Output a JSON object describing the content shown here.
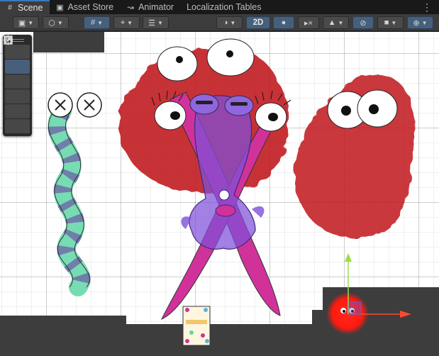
{
  "tabs": [
    {
      "label": "Scene",
      "icon": "grid-icon",
      "active": true
    },
    {
      "label": "Asset Store",
      "icon": "shopping-bag-icon",
      "active": false
    },
    {
      "label": "Animator",
      "icon": "animator-icon",
      "active": false
    },
    {
      "label": "Localization Tables",
      "icon": "",
      "active": false
    }
  ],
  "toolbar": {
    "mode_2d_label": "2D"
  },
  "tools": [
    {
      "name": "hand-tool",
      "icon": "hand-icon",
      "selected": false
    },
    {
      "name": "move-tool",
      "icon": "move-arrows-icon",
      "selected": true
    },
    {
      "name": "rotate-tool",
      "icon": "rotate-icon",
      "selected": false
    },
    {
      "name": "scale-tool",
      "icon": "scale-icon",
      "selected": false
    },
    {
      "name": "rect-tool",
      "icon": "rect-transform-icon",
      "selected": false
    },
    {
      "name": "transform-tool",
      "icon": "transform-icon",
      "selected": false
    }
  ],
  "colors": {
    "accent": "#46607c",
    "red_monster": "#c0141e",
    "purple_monster": "#7f4fd9",
    "pink_arms": "#d0329a",
    "teal_stripes": "#5fd6a6",
    "gizmo_red": "#ff2a1a",
    "gizmo_green": "#9ade4a"
  }
}
